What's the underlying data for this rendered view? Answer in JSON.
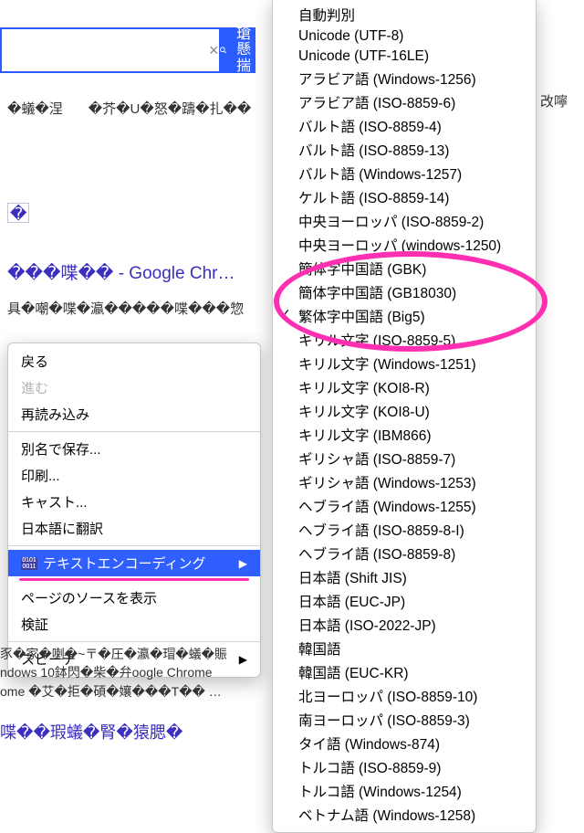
{
  "search": {
    "clear_glyph": "×",
    "button_label": "瑲懸揣"
  },
  "tabs": [
    "�蟻�涅",
    "�芥�U�怒�躊�扎��"
  ],
  "side_garble": "改嚀",
  "result": {
    "diamond": "�",
    "title": "���喋�� - Google Chr…",
    "sub": "具�嘲�喋�瀛�����喋���惣"
  },
  "context_menu": {
    "back": "戻る",
    "forward": "進む",
    "reload": "再読み込み",
    "save_as": "別名で保存...",
    "print": "印刷...",
    "cast": "キャスト...",
    "translate": "日本語に翻訳",
    "encoding": "テキストエンコーディング",
    "view_source": "ページのソースを表示",
    "inspect": "検証",
    "speech": "スピーチ"
  },
  "below": [
    "豕�家�喇�~〒�圧�瀛�瑁�蟻�賑",
    "ndows 10鉢閃�柴�弁oogle Chrome",
    "ome �艾�拒�碩�孃���T�� …"
  ],
  "below_title": "喋��瑕蟻�腎�猿腮�",
  "encodings": [
    {
      "label": "自動判別",
      "checked": false
    },
    {
      "label": "Unicode (UTF-8)",
      "checked": false
    },
    {
      "label": "Unicode (UTF-16LE)",
      "checked": false
    },
    {
      "label": "アラビア語 (Windows-1256)",
      "checked": false
    },
    {
      "label": "アラビア語 (ISO-8859-6)",
      "checked": false
    },
    {
      "label": "バルト語 (ISO-8859-4)",
      "checked": false
    },
    {
      "label": "バルト語 (ISO-8859-13)",
      "checked": false
    },
    {
      "label": "バルト語 (Windows-1257)",
      "checked": false
    },
    {
      "label": "ケルト語 (ISO-8859-14)",
      "checked": false
    },
    {
      "label": "中央ヨーロッパ (ISO-8859-2)",
      "checked": false
    },
    {
      "label": "中央ヨーロッパ (windows-1250)",
      "checked": false
    },
    {
      "label": "簡体字中国語 (GBK)",
      "checked": false
    },
    {
      "label": "簡体字中国語 (GB18030)",
      "checked": false
    },
    {
      "label": "繁体字中国語 (Big5)",
      "checked": true
    },
    {
      "label": "キリル文字 (ISO-8859-5)",
      "checked": false
    },
    {
      "label": "キリル文字 (Windows-1251)",
      "checked": false
    },
    {
      "label": "キリル文字 (KOI8-R)",
      "checked": false
    },
    {
      "label": "キリル文字 (KOI8-U)",
      "checked": false
    },
    {
      "label": "キリル文字 (IBM866)",
      "checked": false
    },
    {
      "label": "ギリシャ語 (ISO-8859-7)",
      "checked": false
    },
    {
      "label": "ギリシャ語 (Windows-1253)",
      "checked": false
    },
    {
      "label": "ヘブライ語 (Windows-1255)",
      "checked": false
    },
    {
      "label": "ヘブライ語 (ISO-8859-8-I)",
      "checked": false
    },
    {
      "label": "ヘブライ語 (ISO-8859-8)",
      "checked": false
    },
    {
      "label": "日本語 (Shift JIS)",
      "checked": false
    },
    {
      "label": "日本語 (EUC-JP)",
      "checked": false
    },
    {
      "label": "日本語 (ISO-2022-JP)",
      "checked": false
    },
    {
      "label": "韓国語",
      "checked": false
    },
    {
      "label": "韓国語 (EUC-KR)",
      "checked": false
    },
    {
      "label": "北ヨーロッパ (ISO-8859-10)",
      "checked": false
    },
    {
      "label": "南ヨーロッパ (ISO-8859-3)",
      "checked": false
    },
    {
      "label": "タイ語 (Windows-874)",
      "checked": false
    },
    {
      "label": "トルコ語 (ISO-8859-9)",
      "checked": false
    },
    {
      "label": "トルコ語 (Windows-1254)",
      "checked": false
    },
    {
      "label": "ベトナム語 (Windows-1258)",
      "checked": false
    }
  ]
}
